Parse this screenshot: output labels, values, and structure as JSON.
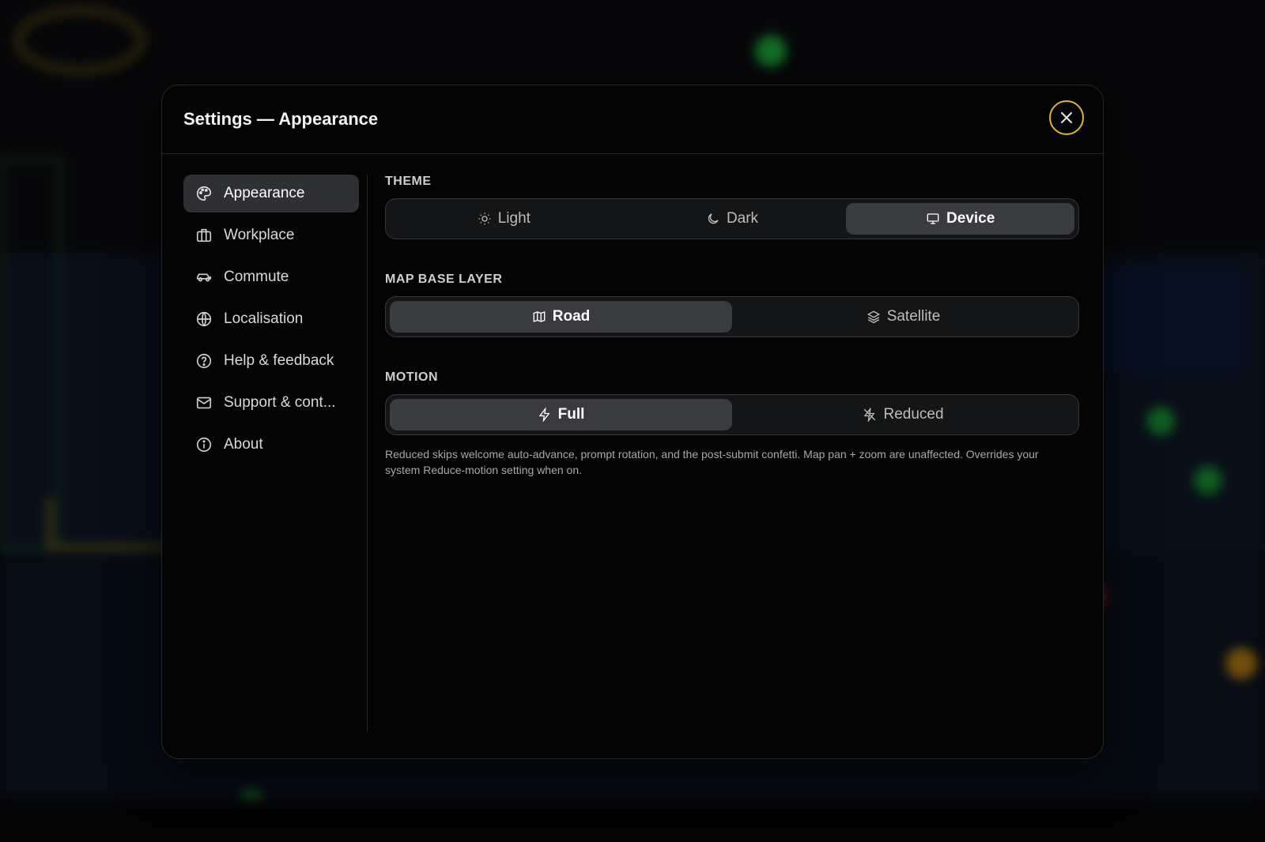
{
  "modal": {
    "title": "Settings — Appearance"
  },
  "sidebar": {
    "items": [
      {
        "label": "Appearance",
        "icon": "palette-icon",
        "active": true
      },
      {
        "label": "Workplace",
        "icon": "briefcase-icon",
        "active": false
      },
      {
        "label": "Commute",
        "icon": "car-icon",
        "active": false
      },
      {
        "label": "Localisation",
        "icon": "globe-icon",
        "active": false
      },
      {
        "label": "Help & feedback",
        "icon": "help-circle-icon",
        "active": false
      },
      {
        "label": "Support & cont...",
        "icon": "mail-icon",
        "active": false
      },
      {
        "label": "About",
        "icon": "info-icon",
        "active": false
      }
    ]
  },
  "theme": {
    "label": "THEME",
    "options": [
      {
        "label": "Light",
        "icon": "sun-icon",
        "selected": false
      },
      {
        "label": "Dark",
        "icon": "moon-icon",
        "selected": false
      },
      {
        "label": "Device",
        "icon": "monitor-icon",
        "selected": true
      }
    ]
  },
  "map_base_layer": {
    "label": "MAP BASE LAYER",
    "options": [
      {
        "label": "Road",
        "icon": "map-icon",
        "selected": true
      },
      {
        "label": "Satellite",
        "icon": "layers-icon",
        "selected": false
      }
    ]
  },
  "motion": {
    "label": "MOTION",
    "options": [
      {
        "label": "Full",
        "icon": "zap-icon",
        "selected": true
      },
      {
        "label": "Reduced",
        "icon": "zap-off-icon",
        "selected": false
      }
    ],
    "help": "Reduced skips welcome auto-advance, prompt rotation, and the post-submit confetti. Map pan + zoom are unaffected. Overrides your system Reduce-motion setting when on."
  },
  "colors": {
    "accent": "#e6b422",
    "selected_bg": "#3a3b3e",
    "modal_bg": "#040404"
  }
}
